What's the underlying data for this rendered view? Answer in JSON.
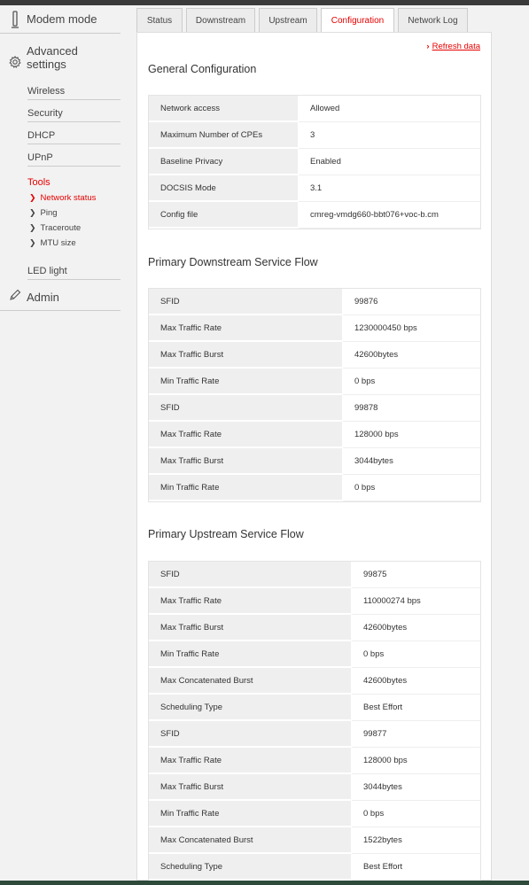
{
  "sidebar": {
    "modem_mode": "Modem mode",
    "advanced_settings": "Advanced settings",
    "items": [
      "Wireless",
      "Security",
      "DHCP",
      "UPnP"
    ],
    "tools": "Tools",
    "tools_items": [
      "Network status",
      "Ping",
      "Traceroute",
      "MTU size"
    ],
    "led_light": "LED light",
    "admin": "Admin"
  },
  "tabs": [
    "Status",
    "Downstream",
    "Upstream",
    "Configuration",
    "Network Log"
  ],
  "refresh_label": "Refresh data",
  "general": {
    "title": "General Configuration",
    "rows": [
      {
        "k": "Network access",
        "v": "Allowed"
      },
      {
        "k": "Maximum Number of CPEs",
        "v": "3"
      },
      {
        "k": "Baseline Privacy",
        "v": "Enabled"
      },
      {
        "k": "DOCSIS Mode",
        "v": "3.1"
      },
      {
        "k": "Config file",
        "v": "cmreg-vmdg660-bbt076+voc-b.cm"
      }
    ]
  },
  "downstream": {
    "title": "Primary Downstream Service Flow",
    "rows": [
      {
        "k": "SFID",
        "v": "99876"
      },
      {
        "k": "Max Traffic Rate",
        "v": "1230000450 bps"
      },
      {
        "k": "Max Traffic Burst",
        "v": "42600bytes"
      },
      {
        "k": "Min Traffic Rate",
        "v": "0 bps"
      },
      {
        "k": "SFID",
        "v": "99878"
      },
      {
        "k": "Max Traffic Rate",
        "v": "128000 bps"
      },
      {
        "k": "Max Traffic Burst",
        "v": "3044bytes"
      },
      {
        "k": "Min Traffic Rate",
        "v": "0 bps"
      }
    ]
  },
  "upstream": {
    "title": "Primary Upstream Service Flow",
    "rows": [
      {
        "k": "SFID",
        "v": "99875"
      },
      {
        "k": "Max Traffic Rate",
        "v": "110000274 bps"
      },
      {
        "k": "Max Traffic Burst",
        "v": "42600bytes"
      },
      {
        "k": "Min Traffic Rate",
        "v": "0 bps"
      },
      {
        "k": "Max Concatenated Burst",
        "v": "42600bytes"
      },
      {
        "k": "Scheduling Type",
        "v": "Best Effort"
      },
      {
        "k": "SFID",
        "v": "99877"
      },
      {
        "k": "Max Traffic Rate",
        "v": "128000 bps"
      },
      {
        "k": "Max Traffic Burst",
        "v": "3044bytes"
      },
      {
        "k": "Min Traffic Rate",
        "v": "0 bps"
      },
      {
        "k": "Max Concatenated Burst",
        "v": "1522bytes"
      },
      {
        "k": "Scheduling Type",
        "v": "Best Effort"
      }
    ]
  },
  "colors": {
    "accent": "#e60000",
    "key_bg": "#efefef"
  }
}
